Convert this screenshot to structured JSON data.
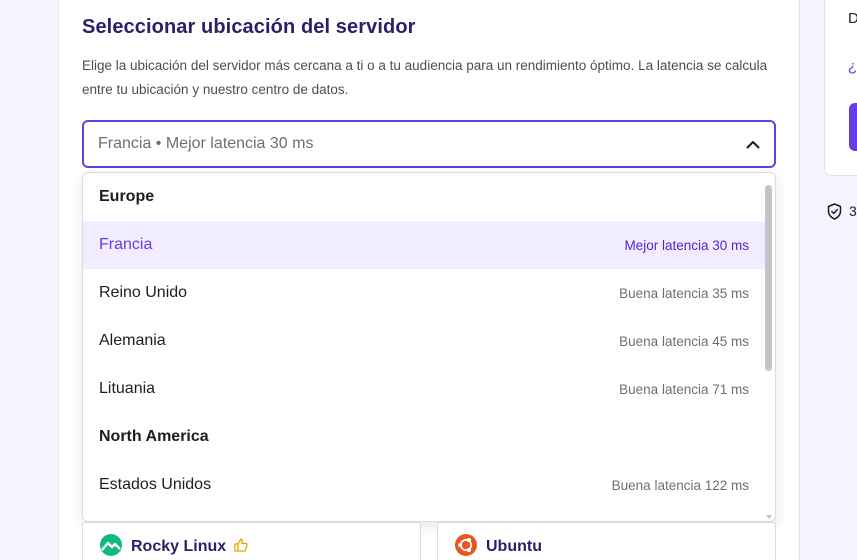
{
  "section": {
    "title": "Seleccionar ubicación del servidor",
    "description": "Elige la ubicación del servidor más cercana a ti o a tu audiencia para un rendimiento óptimo. La latencia se calcula entre tu ubicación y nuestro centro de datos."
  },
  "select": {
    "value": "Francia • Mejor latencia 30 ms"
  },
  "dropdown": {
    "options": [
      {
        "type": "group",
        "name": "Europe",
        "latency": ""
      },
      {
        "type": "option",
        "name": "Francia",
        "latency": "Mejor latencia 30 ms",
        "selected": true
      },
      {
        "type": "option",
        "name": "Reino Unido",
        "latency": "Buena latencia 35 ms"
      },
      {
        "type": "option",
        "name": "Alemania",
        "latency": "Buena latencia 45 ms"
      },
      {
        "type": "option",
        "name": "Lituania",
        "latency": "Buena latencia 71 ms"
      },
      {
        "type": "group",
        "name": "North America",
        "latency": ""
      },
      {
        "type": "option",
        "name": "Estados Unidos",
        "latency": "Buena latencia 122 ms"
      }
    ]
  },
  "os_cards": [
    {
      "name": "Rocky Linux",
      "icon": "rocky-linux-logo-icon",
      "badge_icon": "thumbs-up-icon"
    },
    {
      "name": "Ubuntu",
      "icon": "ubuntu-logo-icon"
    }
  ],
  "right_panel": {
    "text1": "D",
    "text2": "¿",
    "shield_text": "3"
  },
  "colors": {
    "accent": "#673de6",
    "title": "#2f1c6a",
    "selected_bg": "#f1ecff",
    "rocky_green": "#10b981",
    "ubuntu_orange": "#e95420"
  }
}
